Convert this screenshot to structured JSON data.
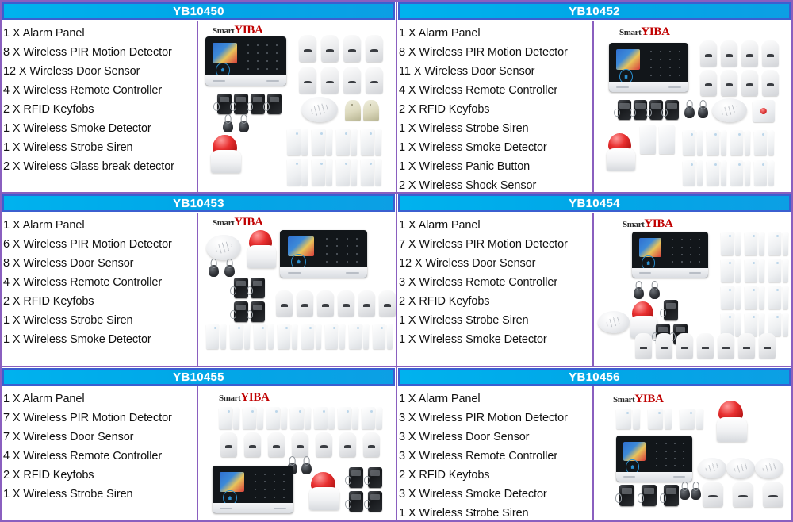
{
  "page": {
    "brand_prefix": "Smart",
    "brand_name": "YIBA"
  },
  "products": [
    {
      "model": "YB10450",
      "items": [
        "1 X Alarm Panel",
        "8 X Wireless PIR Motion Detector",
        "12 X Wireless Door Sensor",
        "4 X Wireless Remote Controller",
        "2 X RFID Keyfobs",
        "1 X Wireless Smoke Detector",
        "1 X Wireless Strobe Siren",
        "2 X Wireless Glass break detector"
      ]
    },
    {
      "model": "YB10452",
      "items": [
        "1 X Alarm Panel",
        "8 X Wireless PIR Motion Detector",
        "11 X Wireless Door Sensor",
        "4 X Wireless Remote Controller",
        "2 X RFID Keyfobs",
        "1 X Wireless Strobe Siren",
        "1 X Wireless Smoke Detector",
        "1 X Wireless Panic Button",
        "2 X Wireless Shock Sensor"
      ]
    },
    {
      "model": "YB10453",
      "items": [
        "1 X Alarm Panel",
        "6 X Wireless PIR Motion Detector",
        "8 X Wireless Door Sensor",
        "4 X Wireless Remote Controller",
        "2 X RFID Keyfobs",
        "1 X Wireless Strobe Siren",
        "1 X Wireless Smoke Detector"
      ]
    },
    {
      "model": "YB10454",
      "items": [
        "1 X Alarm Panel",
        "7 X Wireless PIR Motion Detector",
        "12 X Wireless Door Sensor",
        "3 X Wireless Remote Controller",
        "2 X RFID Keyfobs",
        "1 X Wireless Strobe Siren",
        "1 X Wireless Smoke Detector"
      ]
    },
    {
      "model": "YB10455",
      "items": [
        "1 X Alarm Panel",
        "7 X Wireless PIR Motion Detector",
        "7 X Wireless Door Sensor",
        "4 X Wireless Remote Controller",
        "2 X RFID Keyfobs",
        "1 X Wireless Strobe Siren"
      ]
    },
    {
      "model": "YB10456",
      "items": [
        "1 X Alarm Panel",
        "3 X Wireless PIR Motion Detector",
        "3 X Wireless Door Sensor",
        "3 X Wireless Remote Controller",
        "2 X RFID Keyfobs",
        "3 X Wireless Smoke Detector",
        "1 X Wireless Strobe Siren"
      ]
    }
  ],
  "colors": {
    "header_start": "#00b2ee",
    "header_end": "#0c9fe4",
    "header_border": "#3b5fd0",
    "cell_border": "#8a5fbf",
    "header_text": "#ffffff",
    "spec_text": "#111111",
    "brand_red": "#c00000",
    "siren_red": "#e83030"
  }
}
